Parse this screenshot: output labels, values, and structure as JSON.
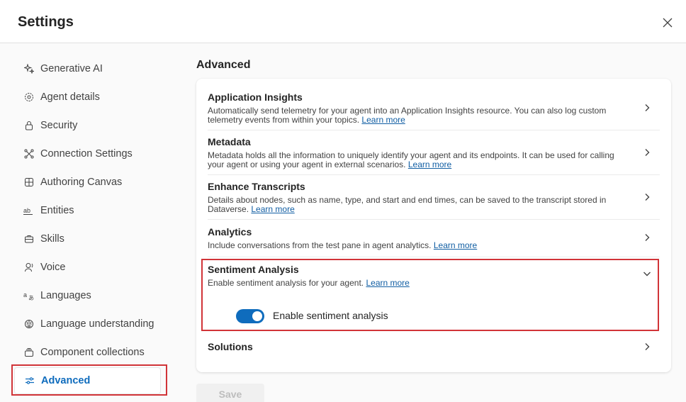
{
  "header": {
    "title": "Settings",
    "close_icon": "close-icon"
  },
  "sidebar": {
    "items": [
      {
        "label": "Generative AI",
        "icon": "sparkle-icon"
      },
      {
        "label": "Agent details",
        "icon": "gear-icon"
      },
      {
        "label": "Security",
        "icon": "lock-icon"
      },
      {
        "label": "Connection Settings",
        "icon": "connector-icon"
      },
      {
        "label": "Authoring Canvas",
        "icon": "grid-icon"
      },
      {
        "label": "Entities",
        "icon": "text-ab-icon"
      },
      {
        "label": "Skills",
        "icon": "briefcase-icon"
      },
      {
        "label": "Voice",
        "icon": "voice-icon"
      },
      {
        "label": "Languages",
        "icon": "translate-icon"
      },
      {
        "label": "Language understanding",
        "icon": "brain-icon"
      },
      {
        "label": "Component collections",
        "icon": "collection-icon"
      },
      {
        "label": "Advanced",
        "icon": "sliders-icon",
        "active": true
      }
    ]
  },
  "main": {
    "title": "Advanced",
    "rows": [
      {
        "title": "Application Insights",
        "desc": "Automatically send telemetry for your agent into an Application Insights resource. You can also log custom telemetry events from within your topics.",
        "link": "Learn more"
      },
      {
        "title": "Metadata",
        "desc": "Metadata holds all the information to uniquely identify your agent and its endpoints. It can be used for calling your agent or using your agent in external scenarios.",
        "link": "Learn more"
      },
      {
        "title": "Enhance Transcripts",
        "desc": "Details about nodes, such as name, type, and start and end times, can be saved to the transcript stored in Dataverse.",
        "link": "Learn more"
      },
      {
        "title": "Analytics",
        "desc": "Include conversations from the test pane in agent analytics.",
        "link": "Learn more"
      },
      {
        "title": "Sentiment Analysis",
        "desc": "Enable sentiment analysis for your agent.",
        "link": "Learn more",
        "toggle_label": "Enable sentiment analysis",
        "toggle_on": true
      },
      {
        "title": "Solutions"
      }
    ],
    "save_label": "Save"
  },
  "colors": {
    "accent": "#0f6cbd",
    "highlight": "#d13438"
  }
}
